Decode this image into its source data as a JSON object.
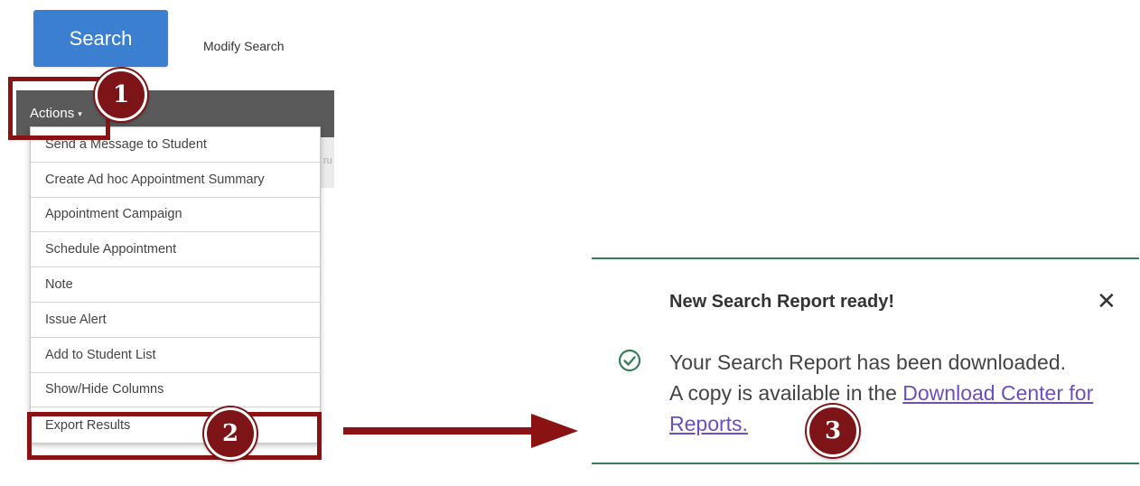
{
  "search": {
    "button_label": "Search",
    "modify_label": "Modify Search"
  },
  "actions": {
    "label": "Actions",
    "caret": "▾",
    "hint": "ru"
  },
  "menu": {
    "items": [
      {
        "label": "Send a Message to Student"
      },
      {
        "label": "Create Ad hoc Appointment Summary"
      },
      {
        "label": "Appointment Campaign"
      },
      {
        "label": "Schedule Appointment"
      },
      {
        "label": "Note"
      },
      {
        "label": "Issue Alert"
      },
      {
        "label": "Add to Student List"
      },
      {
        "label": "Show/Hide Columns"
      },
      {
        "label": "Export Results"
      }
    ]
  },
  "callouts": {
    "step1": "1",
    "step2": "2",
    "step3": "3"
  },
  "toast": {
    "title": "New Search Report ready!",
    "close_glyph": "✕",
    "message_line1": "Your Search Report has been downloaded.",
    "message_line2_prefix": "A copy is available in the ",
    "link_text": "Download Center for Reports."
  },
  "colors": {
    "primary_button": "#3b7fd0",
    "highlight_red": "#8b1212",
    "badge_red": "#7d1518",
    "toast_green": "#3a7d5b",
    "link_purple": "#6d4ec2"
  },
  "icons": {
    "check": "check-circle-icon",
    "close": "close-icon",
    "caret": "caret-down-icon",
    "arrow": "arrow-right-icon"
  }
}
